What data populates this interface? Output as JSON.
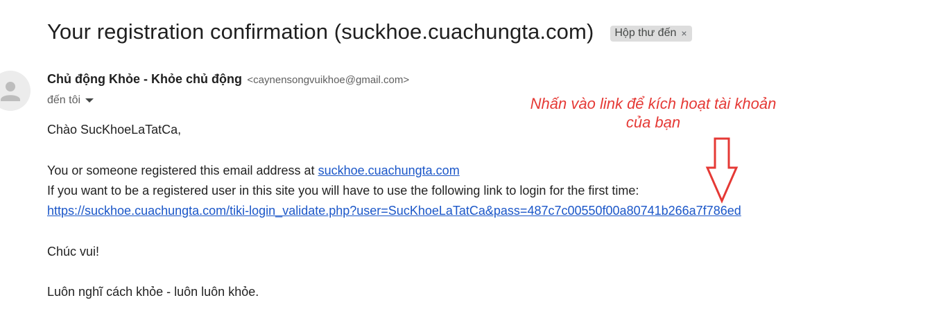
{
  "email": {
    "subject": "Your registration confirmation (suckhoe.cuachungta.com)",
    "label": "Hộp thư đến",
    "label_close": "×",
    "sender_name": "Chủ động Khỏe - Khỏe chủ động",
    "sender_email": "<caynensongvuikhoe@gmail.com>",
    "to": "đến tôi",
    "avatar_icon": "person-icon"
  },
  "body": {
    "greeting": "Chào SucKhoeLaTatCa,",
    "line1_prefix": "You or someone registered this email address at ",
    "line1_link": "suckhoe.cuachungta.com",
    "line2": "If you want to be a registered user in this site you will have to use the following link to login for the first time:",
    "activation_link": "https://suckhoe.cuachungta.com/tiki-login_validate.php?user=SucKhoeLaTatCa&pass=487c7c00550f00a80741b266a7f786ed",
    "closing": "Chúc vui!",
    "signature": "Luôn nghĩ cách khỏe - luôn luôn khỏe."
  },
  "annotation": {
    "line1": "Nhấn vào link để kích hoạt tài khoản",
    "line2": "của bạn",
    "color": "#e53935",
    "arrow_icon": "down-arrow-icon"
  }
}
